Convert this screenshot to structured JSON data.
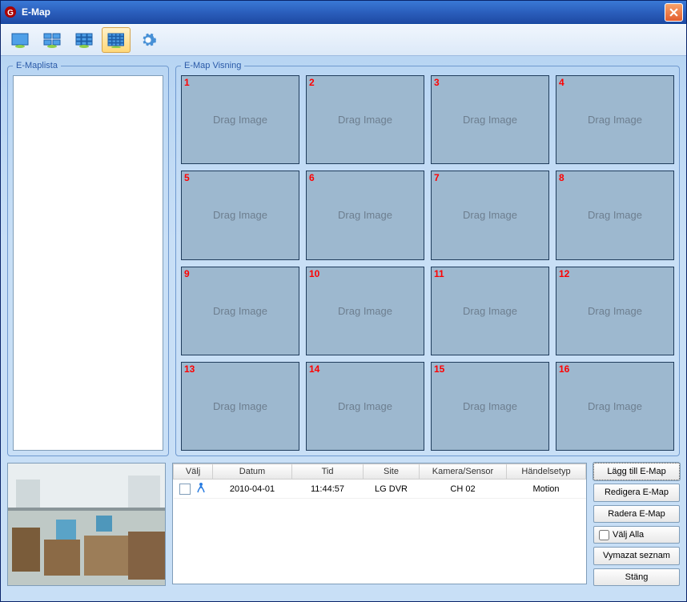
{
  "window": {
    "title": "E-Map"
  },
  "list": {
    "legend": "E-Maplista"
  },
  "view": {
    "legend": "E-Map Visning",
    "drag_label": "Drag Image",
    "cells": [
      "1",
      "2",
      "3",
      "4",
      "5",
      "6",
      "7",
      "8",
      "9",
      "10",
      "11",
      "12",
      "13",
      "14",
      "15",
      "16"
    ]
  },
  "table": {
    "headers": {
      "sel": "Välj",
      "date": "Datum",
      "time": "Tid",
      "site": "Site",
      "cam": "Kamera/Sensor",
      "type": "Händelsetyp"
    },
    "row": {
      "date": "2010-04-01",
      "time": "11:44:57",
      "site": "LG DVR",
      "cam": "CH 02",
      "type": "Motion"
    }
  },
  "buttons": {
    "add": "Lägg till E-Map",
    "edit": "Redigera E-Map",
    "delete": "Radera E-Map",
    "select_all": "Välj Alla",
    "clear": "Vymazat seznam",
    "close": "Stäng"
  }
}
